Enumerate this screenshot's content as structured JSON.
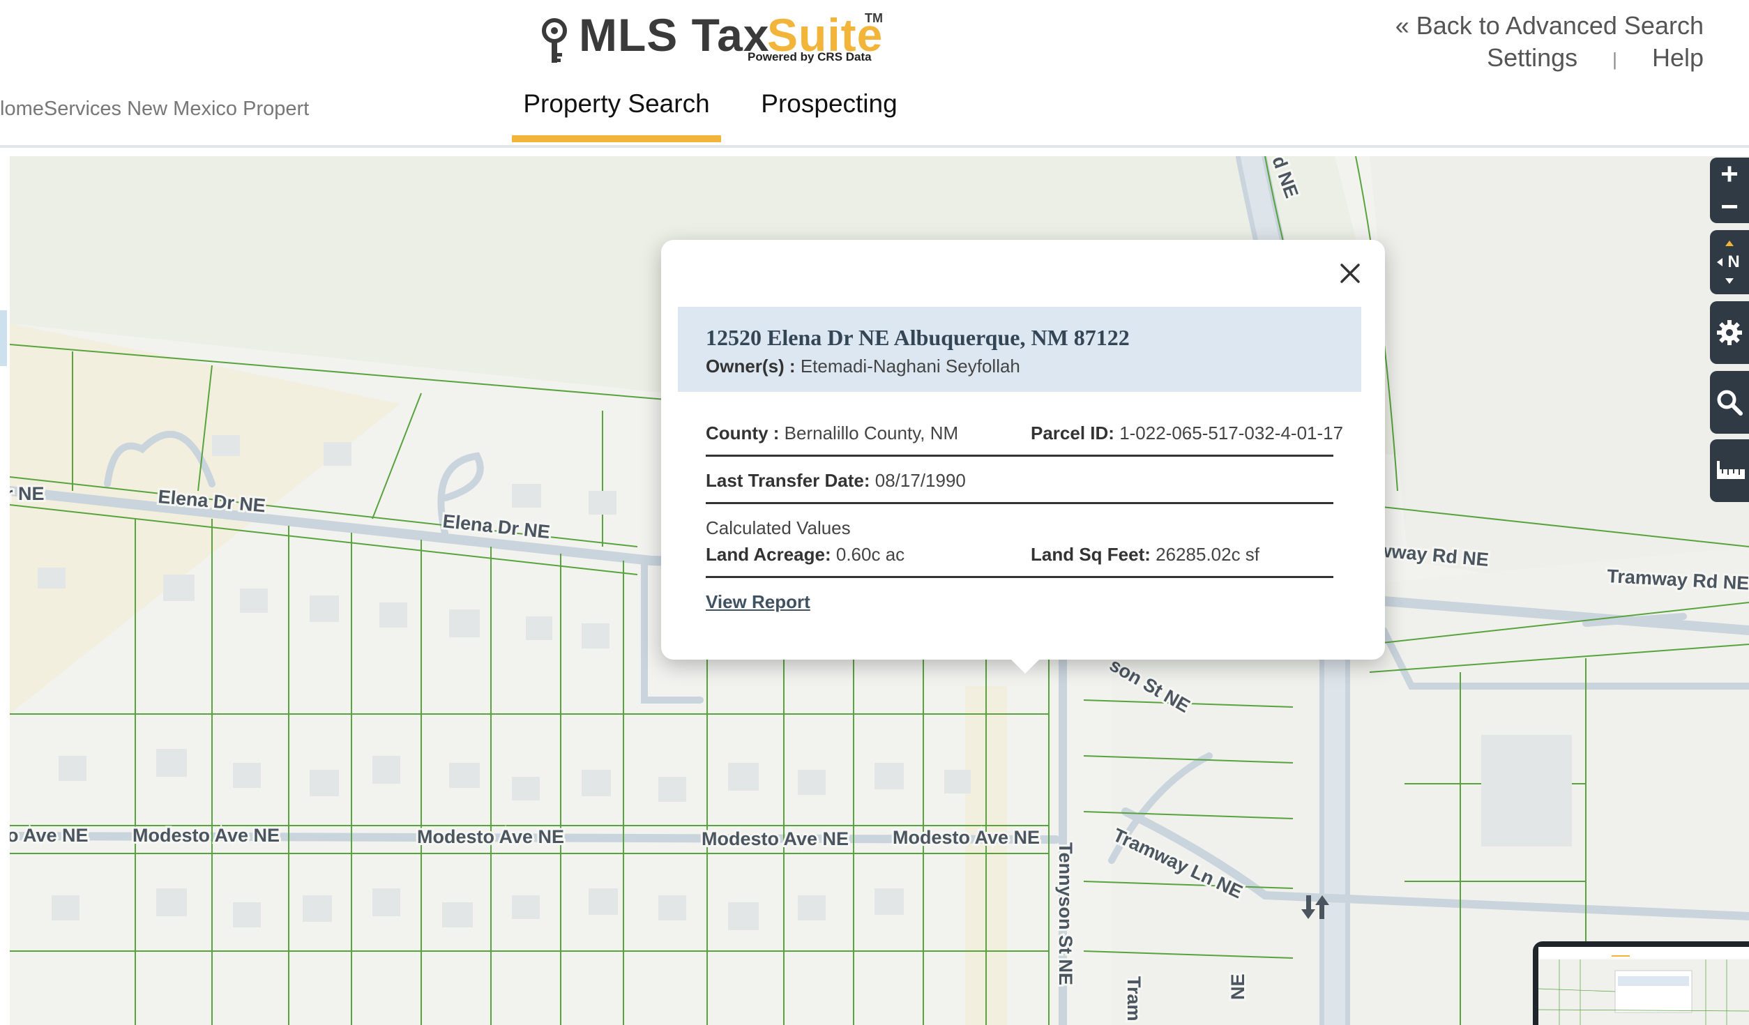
{
  "header": {
    "logo": {
      "word1": "MLS Tax",
      "word2": "Suite",
      "tm": "TM",
      "powered_by": "Powered by CRS Data"
    },
    "back_link": "« Back to Advanced Search",
    "settings": "Settings",
    "separator": "|",
    "help": "Help",
    "org_name": "lomeServices New Mexico Propert",
    "tabs": [
      {
        "label": "Property Search",
        "active": true
      },
      {
        "label": "Prospecting",
        "active": false
      }
    ],
    "accent_color": "#f2b53a"
  },
  "map": {
    "road_labels": [
      "r NE",
      "Elena Dr NE",
      "Elena Dr NE",
      "wway Rd NE",
      "Tramway Rd NE",
      "o Ave NE",
      "Modesto Ave NE",
      "Modesto Ave NE",
      "Modesto Ave NE",
      "Modesto Ave NE",
      "Tennyson St NE",
      "Tramway Ln NE",
      "son St NE",
      "d NE",
      "Tram",
      "NE"
    ],
    "controls": {
      "zoom_in": "+",
      "zoom_out": "−",
      "compass": "N",
      "settings_icon": "gear-icon",
      "search_icon": "search-icon",
      "measure_icon": "ruler-icon"
    }
  },
  "popup": {
    "address": "12520 Elena Dr NE Albuquerque, NM 87122",
    "owner_label": "Owner(s) :",
    "owner": "Etemadi-Naghani Seyfollah",
    "county_label": "County :",
    "county": "Bernalillo County, NM",
    "parcel_label": "Parcel ID:",
    "parcel": "1-022-065-517-032-4-01-17",
    "transfer_label": "Last Transfer Date:",
    "transfer_date": "08/17/1990",
    "calculated_values": "Calculated Values",
    "acreage_label": "Land Acreage:",
    "acreage": "0.60c ac",
    "sqft_label": "Land Sq Feet:",
    "sqft": "26285.02c sf",
    "view_report": "View Report"
  },
  "colors": {
    "parcel_line": "#58a33e",
    "street": "#c9d4dd",
    "map_bg": "#f2f2ef",
    "popup_header_bg": "#dce7f1",
    "control_bg": "#2f3a44"
  }
}
